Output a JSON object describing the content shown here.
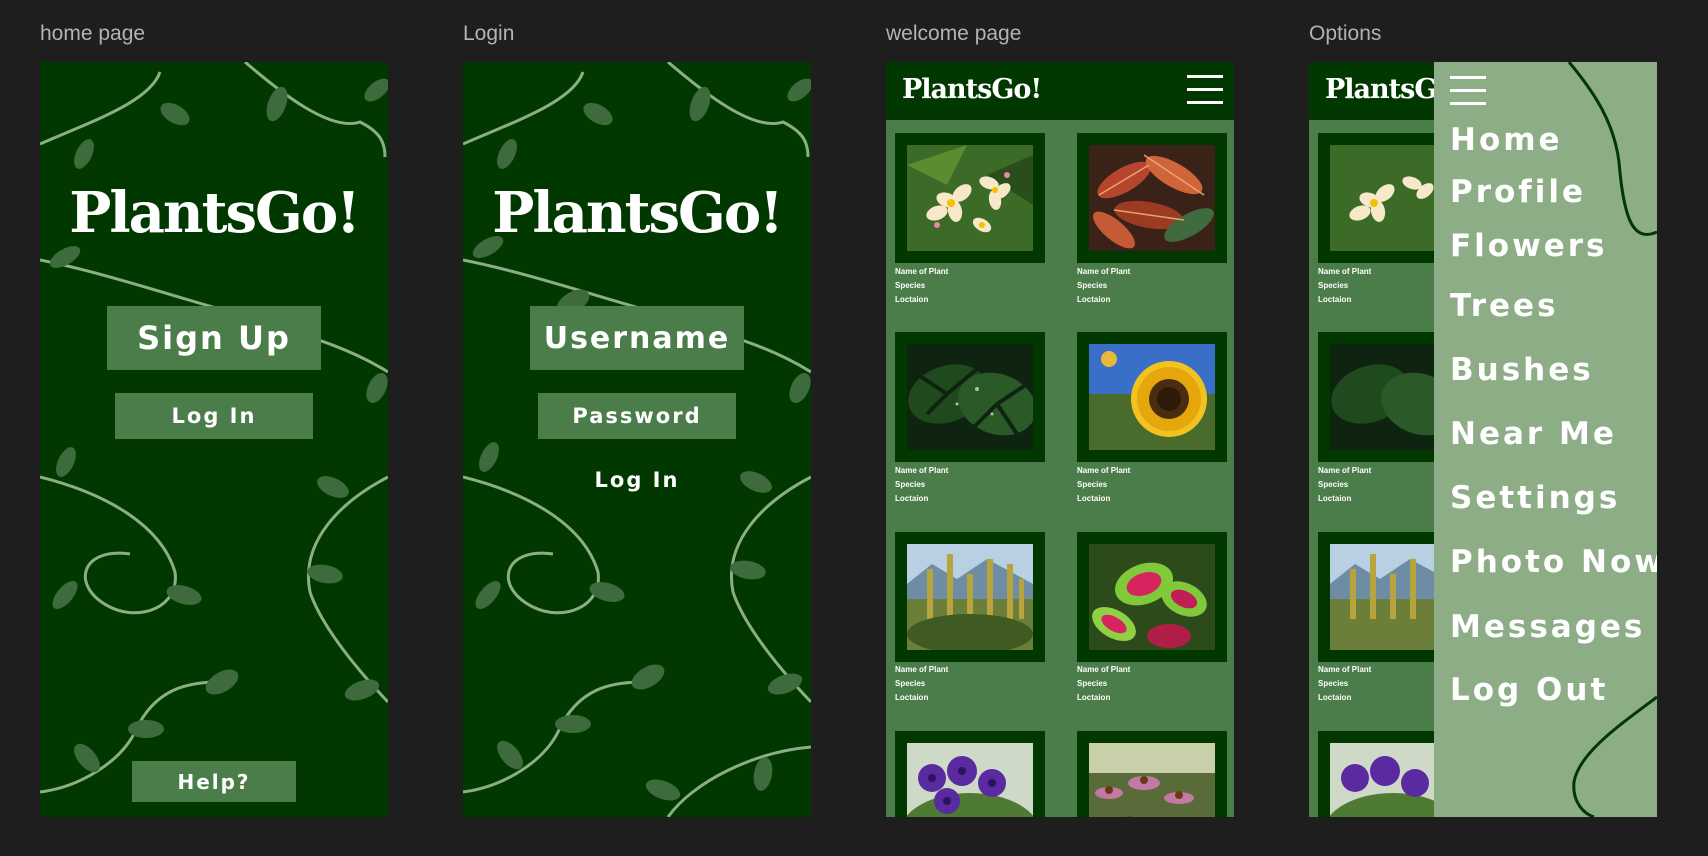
{
  "frames": {
    "home": {
      "label": "home page"
    },
    "login": {
      "label": "Login"
    },
    "welcome": {
      "label": "welcome page"
    },
    "options": {
      "label": "Options"
    }
  },
  "brand": {
    "name": "PlantsGo!",
    "name_small": "PlantsGo!",
    "name_small_cut": "PlantsGo"
  },
  "home": {
    "signup_label": "Sign Up",
    "login_label": "Log In",
    "help_label": "Help?"
  },
  "login": {
    "username_label": "Username",
    "password_label": "Password",
    "login_label": "Log In"
  },
  "welcome": {
    "cards": [
      {
        "name": "Name of Plant",
        "species": "Species",
        "location": "Loctaion"
      },
      {
        "name": "Name of Plant",
        "species": "Species",
        "location": "Loctaion"
      },
      {
        "name": "Name of Plant",
        "species": "Species",
        "location": "Loctaion"
      },
      {
        "name": "Name of Plant",
        "species": "Species",
        "location": "Loctaion"
      },
      {
        "name": "Name of Plant",
        "species": "Species",
        "location": "Loctaion"
      },
      {
        "name": "Name of Plant",
        "species": "Species",
        "location": "Loctaion"
      }
    ]
  },
  "options": {
    "menu": [
      {
        "label": "Home"
      },
      {
        "label": "Profile"
      },
      {
        "label": "Flowers"
      },
      {
        "label": "Trees"
      },
      {
        "label": "Bushes"
      },
      {
        "label": "Near Me"
      },
      {
        "label": "Settings"
      },
      {
        "label": "Photo Now"
      },
      {
        "label": "Messages"
      },
      {
        "label": "Log Out"
      }
    ]
  },
  "colors": {
    "canvas": "#1e1e1e",
    "dark_green": "#003800",
    "mid_green": "#4a7d4a",
    "menu_green": "#8cad86",
    "vine": "#8cad86",
    "leaf": "#3d6b3d"
  },
  "icons": {
    "menu": "hamburger-icon"
  }
}
